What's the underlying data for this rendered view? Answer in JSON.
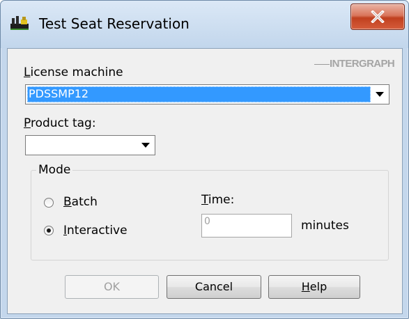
{
  "window": {
    "title": "Test Seat Reservation",
    "icons": {
      "app": "license-app-icon",
      "close": "close-x-icon"
    }
  },
  "branding": {
    "logo_text": "INTERGRAPH"
  },
  "license_machine": {
    "label_underlined": "L",
    "label_rest": "icense machine",
    "value": "PDSSMP12",
    "selected": true
  },
  "product_tag": {
    "label_underlined": "P",
    "label_rest": "roduct tag:",
    "value": ""
  },
  "mode": {
    "legend": "Mode",
    "options": [
      {
        "underlined": "B",
        "rest": "atch",
        "checked": false
      },
      {
        "underlined": "I",
        "rest": "nteractive",
        "checked": true
      }
    ]
  },
  "time": {
    "label_underlined": "T",
    "label_rest": "ime:",
    "value": "0",
    "unit": "minutes"
  },
  "buttons": {
    "ok": {
      "label": "OK",
      "enabled": false
    },
    "cancel": {
      "label": "Cancel",
      "enabled": true
    },
    "help": {
      "underlined": "H",
      "rest": "elp",
      "enabled": true
    }
  },
  "colors": {
    "selection": "#3399ff",
    "dialog_bg": "#f0f0f0",
    "frame": "#c4d7ec",
    "close_button": "#c7442a"
  }
}
